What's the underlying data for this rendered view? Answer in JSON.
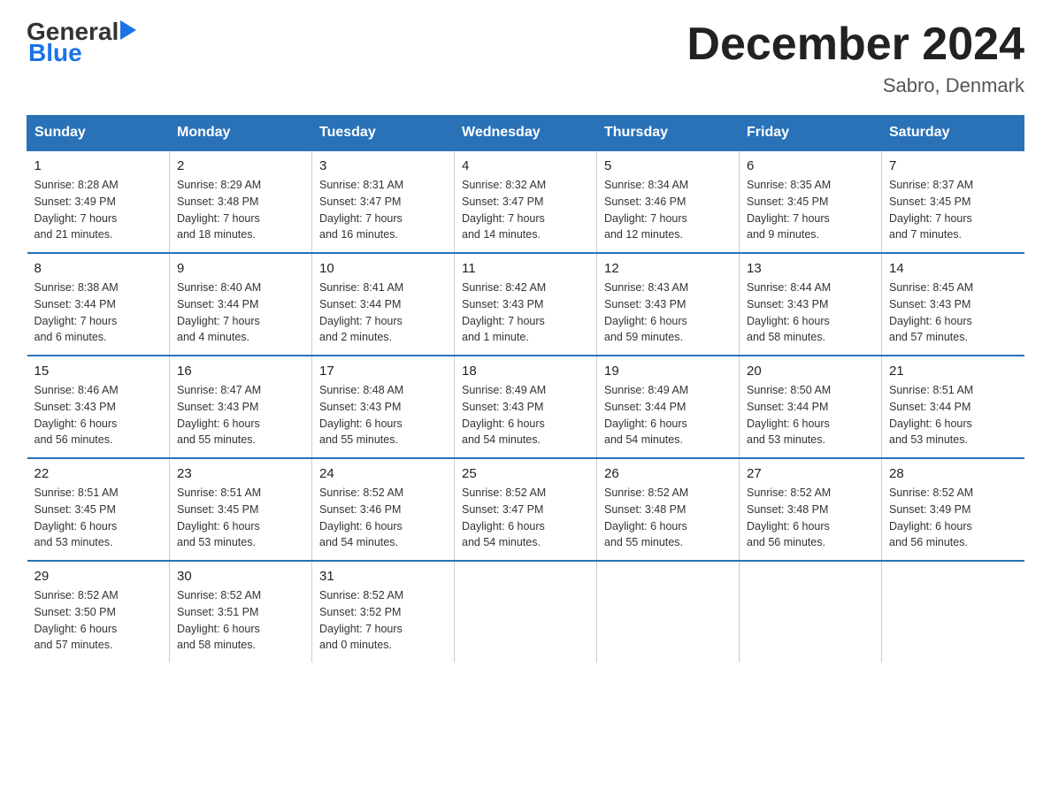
{
  "header": {
    "logo_general": "General",
    "logo_blue": "Blue",
    "month_title": "December 2024",
    "location": "Sabro, Denmark"
  },
  "weekdays": [
    "Sunday",
    "Monday",
    "Tuesday",
    "Wednesday",
    "Thursday",
    "Friday",
    "Saturday"
  ],
  "weeks": [
    [
      {
        "day": "1",
        "sunrise": "Sunrise: 8:28 AM",
        "sunset": "Sunset: 3:49 PM",
        "daylight": "Daylight: 7 hours",
        "daylight2": "and 21 minutes."
      },
      {
        "day": "2",
        "sunrise": "Sunrise: 8:29 AM",
        "sunset": "Sunset: 3:48 PM",
        "daylight": "Daylight: 7 hours",
        "daylight2": "and 18 minutes."
      },
      {
        "day": "3",
        "sunrise": "Sunrise: 8:31 AM",
        "sunset": "Sunset: 3:47 PM",
        "daylight": "Daylight: 7 hours",
        "daylight2": "and 16 minutes."
      },
      {
        "day": "4",
        "sunrise": "Sunrise: 8:32 AM",
        "sunset": "Sunset: 3:47 PM",
        "daylight": "Daylight: 7 hours",
        "daylight2": "and 14 minutes."
      },
      {
        "day": "5",
        "sunrise": "Sunrise: 8:34 AM",
        "sunset": "Sunset: 3:46 PM",
        "daylight": "Daylight: 7 hours",
        "daylight2": "and 12 minutes."
      },
      {
        "day": "6",
        "sunrise": "Sunrise: 8:35 AM",
        "sunset": "Sunset: 3:45 PM",
        "daylight": "Daylight: 7 hours",
        "daylight2": "and 9 minutes."
      },
      {
        "day": "7",
        "sunrise": "Sunrise: 8:37 AM",
        "sunset": "Sunset: 3:45 PM",
        "daylight": "Daylight: 7 hours",
        "daylight2": "and 7 minutes."
      }
    ],
    [
      {
        "day": "8",
        "sunrise": "Sunrise: 8:38 AM",
        "sunset": "Sunset: 3:44 PM",
        "daylight": "Daylight: 7 hours",
        "daylight2": "and 6 minutes."
      },
      {
        "day": "9",
        "sunrise": "Sunrise: 8:40 AM",
        "sunset": "Sunset: 3:44 PM",
        "daylight": "Daylight: 7 hours",
        "daylight2": "and 4 minutes."
      },
      {
        "day": "10",
        "sunrise": "Sunrise: 8:41 AM",
        "sunset": "Sunset: 3:44 PM",
        "daylight": "Daylight: 7 hours",
        "daylight2": "and 2 minutes."
      },
      {
        "day": "11",
        "sunrise": "Sunrise: 8:42 AM",
        "sunset": "Sunset: 3:43 PM",
        "daylight": "Daylight: 7 hours",
        "daylight2": "and 1 minute."
      },
      {
        "day": "12",
        "sunrise": "Sunrise: 8:43 AM",
        "sunset": "Sunset: 3:43 PM",
        "daylight": "Daylight: 6 hours",
        "daylight2": "and 59 minutes."
      },
      {
        "day": "13",
        "sunrise": "Sunrise: 8:44 AM",
        "sunset": "Sunset: 3:43 PM",
        "daylight": "Daylight: 6 hours",
        "daylight2": "and 58 minutes."
      },
      {
        "day": "14",
        "sunrise": "Sunrise: 8:45 AM",
        "sunset": "Sunset: 3:43 PM",
        "daylight": "Daylight: 6 hours",
        "daylight2": "and 57 minutes."
      }
    ],
    [
      {
        "day": "15",
        "sunrise": "Sunrise: 8:46 AM",
        "sunset": "Sunset: 3:43 PM",
        "daylight": "Daylight: 6 hours",
        "daylight2": "and 56 minutes."
      },
      {
        "day": "16",
        "sunrise": "Sunrise: 8:47 AM",
        "sunset": "Sunset: 3:43 PM",
        "daylight": "Daylight: 6 hours",
        "daylight2": "and 55 minutes."
      },
      {
        "day": "17",
        "sunrise": "Sunrise: 8:48 AM",
        "sunset": "Sunset: 3:43 PM",
        "daylight": "Daylight: 6 hours",
        "daylight2": "and 55 minutes."
      },
      {
        "day": "18",
        "sunrise": "Sunrise: 8:49 AM",
        "sunset": "Sunset: 3:43 PM",
        "daylight": "Daylight: 6 hours",
        "daylight2": "and 54 minutes."
      },
      {
        "day": "19",
        "sunrise": "Sunrise: 8:49 AM",
        "sunset": "Sunset: 3:44 PM",
        "daylight": "Daylight: 6 hours",
        "daylight2": "and 54 minutes."
      },
      {
        "day": "20",
        "sunrise": "Sunrise: 8:50 AM",
        "sunset": "Sunset: 3:44 PM",
        "daylight": "Daylight: 6 hours",
        "daylight2": "and 53 minutes."
      },
      {
        "day": "21",
        "sunrise": "Sunrise: 8:51 AM",
        "sunset": "Sunset: 3:44 PM",
        "daylight": "Daylight: 6 hours",
        "daylight2": "and 53 minutes."
      }
    ],
    [
      {
        "day": "22",
        "sunrise": "Sunrise: 8:51 AM",
        "sunset": "Sunset: 3:45 PM",
        "daylight": "Daylight: 6 hours",
        "daylight2": "and 53 minutes."
      },
      {
        "day": "23",
        "sunrise": "Sunrise: 8:51 AM",
        "sunset": "Sunset: 3:45 PM",
        "daylight": "Daylight: 6 hours",
        "daylight2": "and 53 minutes."
      },
      {
        "day": "24",
        "sunrise": "Sunrise: 8:52 AM",
        "sunset": "Sunset: 3:46 PM",
        "daylight": "Daylight: 6 hours",
        "daylight2": "and 54 minutes."
      },
      {
        "day": "25",
        "sunrise": "Sunrise: 8:52 AM",
        "sunset": "Sunset: 3:47 PM",
        "daylight": "Daylight: 6 hours",
        "daylight2": "and 54 minutes."
      },
      {
        "day": "26",
        "sunrise": "Sunrise: 8:52 AM",
        "sunset": "Sunset: 3:48 PM",
        "daylight": "Daylight: 6 hours",
        "daylight2": "and 55 minutes."
      },
      {
        "day": "27",
        "sunrise": "Sunrise: 8:52 AM",
        "sunset": "Sunset: 3:48 PM",
        "daylight": "Daylight: 6 hours",
        "daylight2": "and 56 minutes."
      },
      {
        "day": "28",
        "sunrise": "Sunrise: 8:52 AM",
        "sunset": "Sunset: 3:49 PM",
        "daylight": "Daylight: 6 hours",
        "daylight2": "and 56 minutes."
      }
    ],
    [
      {
        "day": "29",
        "sunrise": "Sunrise: 8:52 AM",
        "sunset": "Sunset: 3:50 PM",
        "daylight": "Daylight: 6 hours",
        "daylight2": "and 57 minutes."
      },
      {
        "day": "30",
        "sunrise": "Sunrise: 8:52 AM",
        "sunset": "Sunset: 3:51 PM",
        "daylight": "Daylight: 6 hours",
        "daylight2": "and 58 minutes."
      },
      {
        "day": "31",
        "sunrise": "Sunrise: 8:52 AM",
        "sunset": "Sunset: 3:52 PM",
        "daylight": "Daylight: 7 hours",
        "daylight2": "and 0 minutes."
      },
      null,
      null,
      null,
      null
    ]
  ]
}
